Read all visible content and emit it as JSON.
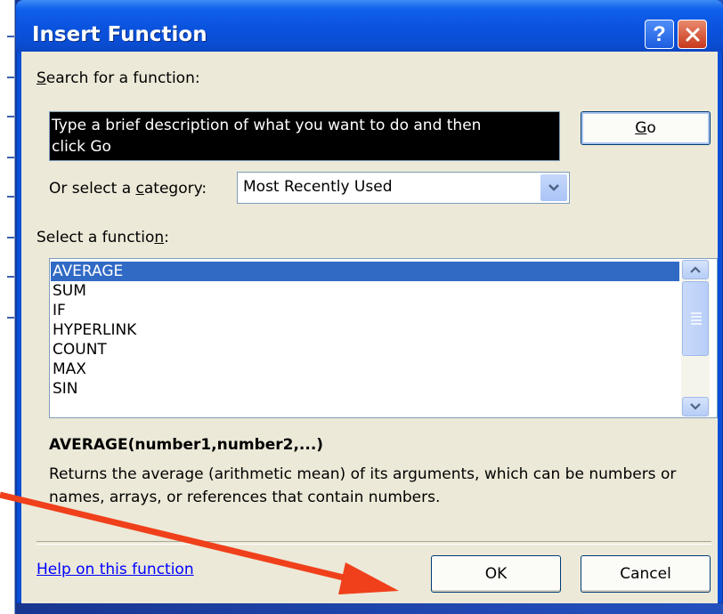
{
  "window": {
    "title": "Insert Function",
    "help_glyph": "?",
    "close_glyph": "✕"
  },
  "search": {
    "label": "Search for a function:",
    "text_line1": "Type a brief description of what you want to do and then",
    "text_line2": "click Go",
    "go_label": "Go"
  },
  "category": {
    "label": "Or select a category:",
    "selected": "Most Recently Used"
  },
  "function_list": {
    "label": "Select a function:",
    "items": [
      "AVERAGE",
      "SUM",
      "IF",
      "HYPERLINK",
      "COUNT",
      "MAX",
      "SIN"
    ],
    "selected_index": 0
  },
  "details": {
    "signature": "AVERAGE(number1,number2,...)",
    "description": "Returns the average (arithmetic mean) of its arguments, which can be numbers or names, arrays, or references that contain numbers."
  },
  "footer": {
    "help_link": "Help on this function",
    "ok_label": "OK",
    "cancel_label": "Cancel"
  },
  "colors": {
    "titlebar": "#0a52de",
    "dialog_body": "#ece9d8",
    "selection": "#316ac5",
    "annotation_arrow": "#f0401b"
  },
  "icons": [
    "help-icon",
    "close-icon",
    "chevron-down-icon",
    "scroll-up-icon",
    "scroll-down-icon"
  ]
}
